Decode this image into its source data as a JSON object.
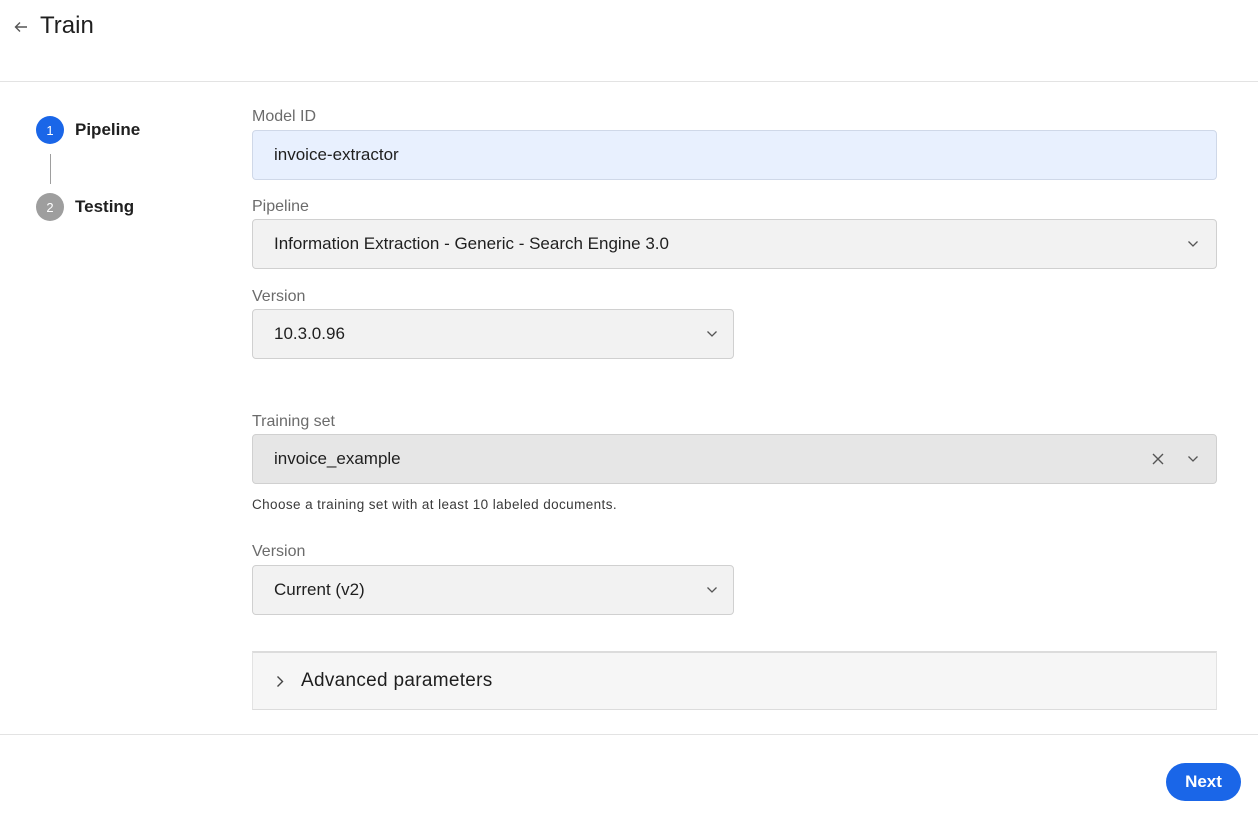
{
  "header": {
    "title": "Train",
    "back_icon": "arrow-left-icon"
  },
  "stepper": {
    "steps": [
      {
        "number": "1",
        "label": "Pipeline",
        "state": "active",
        "color": "#1a66e8"
      },
      {
        "number": "2",
        "label": "Testing",
        "state": "inactive",
        "color": "#9e9e9e"
      }
    ]
  },
  "form": {
    "model_id": {
      "label": "Model ID",
      "value": "invoice-extractor"
    },
    "pipeline": {
      "label": "Pipeline",
      "value": "Information Extraction - Generic - Search Engine 3.0"
    },
    "pipeline_version": {
      "label": "Version",
      "value": "10.3.0.96"
    },
    "training_set": {
      "label": "Training set",
      "value": "invoice_example",
      "helper": "Choose a training set with at least 10 labeled documents."
    },
    "training_set_version": {
      "label": "Version",
      "value": "Current (v2)"
    },
    "advanced": {
      "label": "Advanced parameters"
    }
  },
  "footer": {
    "next_label": "Next"
  },
  "colors": {
    "accent": "#1a66e8",
    "input_bg": "#e8f0fe"
  }
}
